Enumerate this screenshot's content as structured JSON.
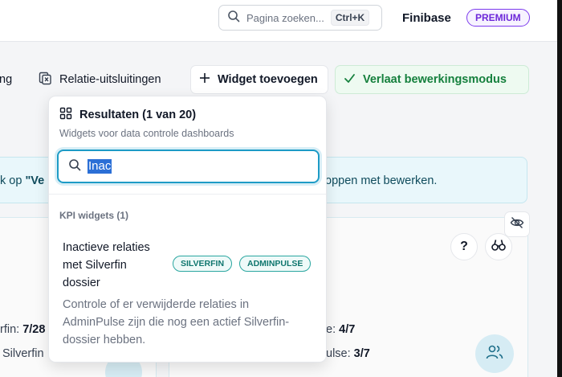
{
  "header": {
    "search_placeholder": "Pagina zoeken...",
    "search_shortcut": "Ctrl+K",
    "brand": "Finibase",
    "plan_badge": "PREMIUM"
  },
  "toolbar": {
    "partial_item": "ng",
    "exclusions_label": "Relatie-uitsluitingen",
    "add_widget_label": "Widget toevoegen",
    "exit_edit_label": "Verlaat bewerkingsmodus"
  },
  "banner": {
    "left_prefix": "k op ",
    "left_bold": "\"Ve",
    "right_text": "oppen met bewerken."
  },
  "cards": {
    "left_line1_label": "rfin: ",
    "left_line1_value": "7/28",
    "left_line2_label": "Silverfin",
    "right_line1_label": "e: ",
    "right_line1_value": "4/7",
    "right_line2_label": "ulse: ",
    "right_line2_value": "3/7"
  },
  "dropdown": {
    "title": "Resultaten (1 van 20)",
    "subtitle": "Widgets voor data controle dashboards",
    "search_value": "Inac",
    "group_label": "KPI widgets (1)",
    "item": {
      "title": "Inactieve relaties met Silverfin dossier",
      "tags": [
        "SILVERFIN",
        "ADMINPULSE"
      ],
      "description": "Controle of er verwijderde relaties in AdminPulse zijn die nog een actief Silverfin-dossier hebben."
    }
  },
  "colors": {
    "accent_teal": "#1d9bc6",
    "premium_purple": "#7c3aed",
    "success_green": "#15803d",
    "tag_teal": "#0f766e"
  }
}
